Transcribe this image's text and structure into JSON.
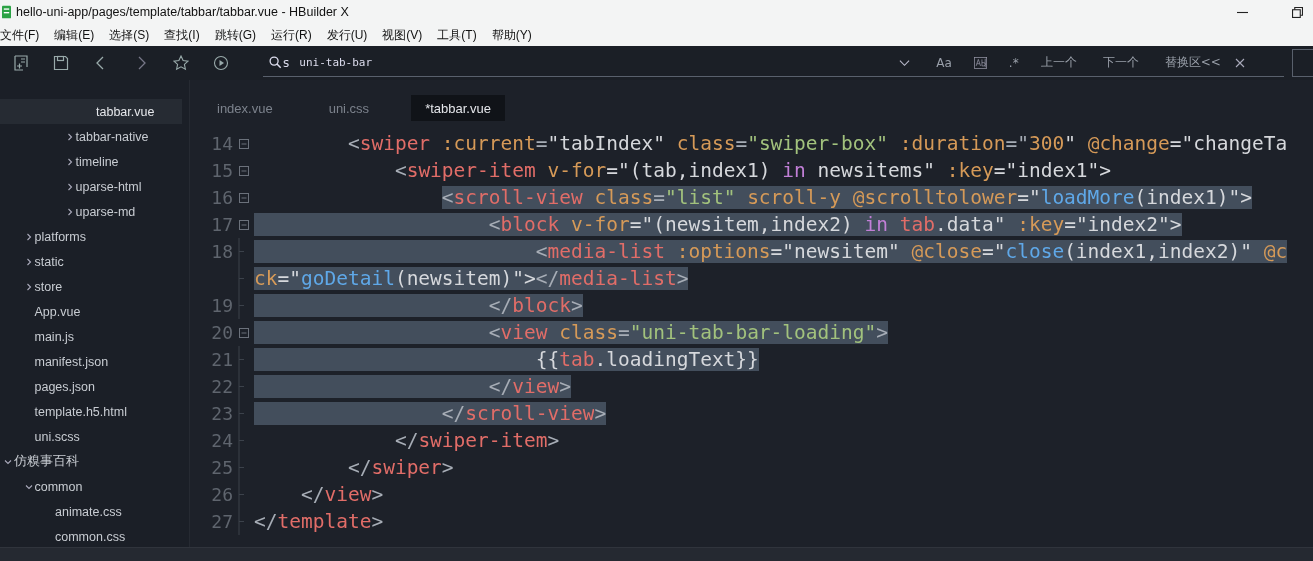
{
  "window": {
    "title": "hello-uni-app/pages/template/tabbar/tabbar.vue - HBuilder X"
  },
  "menu": [
    "文件(F)",
    "编辑(E)",
    "选择(S)",
    "查找(I)",
    "跳转(G)",
    "运行(R)",
    "发行(U)",
    "视图(V)",
    "工具(T)",
    "帮助(Y)"
  ],
  "search": {
    "mode": "s",
    "value": "uni-tab-bar",
    "case_label": "Aa",
    "regex_label": ".*",
    "prev": "上一个",
    "next": "下一个",
    "replace_toggle": "替换区<<"
  },
  "sidebar": {
    "items": [
      {
        "children": [
          {
            "children": [
              {
                "children": [
                  {
                    "children": [
                      {
                        "label": "tabbar.vue",
                        "kind": "file",
                        "selected": true
                      }
                    ]
                  },
                  {
                    "label": "tabbar-native",
                    "kind": "folder",
                    "expanded": false,
                    "selected": false
                  },
                  {
                    "label": "timeline",
                    "kind": "folder",
                    "expanded": false,
                    "selected": false
                  },
                  {
                    "label": "uparse-html",
                    "kind": "folder",
                    "expanded": false,
                    "selected": false
                  },
                  {
                    "label": "uparse-md",
                    "kind": "folder",
                    "expanded": false,
                    "selected": false
                  }
                ]
              }
            ]
          },
          {
            "label": "platforms",
            "kind": "folder",
            "expanded": false,
            "selected": false
          },
          {
            "label": "static",
            "kind": "folder",
            "expanded": false,
            "selected": false
          },
          {
            "label": "store",
            "kind": "folder",
            "expanded": false,
            "selected": false
          },
          {
            "label": "App.vue",
            "kind": "file",
            "selected": false
          },
          {
            "label": "main.js",
            "kind": "file",
            "selected": false
          },
          {
            "label": "manifest.json",
            "kind": "file",
            "selected": false
          },
          {
            "label": "pages.json",
            "kind": "file",
            "selected": false
          },
          {
            "label": "template.h5.html",
            "kind": "file",
            "selected": false
          },
          {
            "label": "uni.scss",
            "kind": "file",
            "selected": false
          }
        ]
      },
      {
        "label": "仿糗事百科",
        "kind": "folder",
        "expanded": true,
        "selected": false,
        "children": [
          {
            "label": "common",
            "kind": "folder",
            "expanded": true,
            "selected": false,
            "children": [
              {
                "label": "animate.css",
                "kind": "file",
                "selected": false
              },
              {
                "label": "common.css",
                "kind": "file",
                "selected": false
              }
            ]
          }
        ]
      }
    ]
  },
  "tabs": [
    {
      "label": "index.vue",
      "selected": false
    },
    {
      "label": "uni.css",
      "selected": false
    },
    {
      "label": "*tabbar.vue",
      "selected": true
    }
  ],
  "code": [
    {
      "number": "14",
      "fold": true,
      "selected": false,
      "tokens": [
        {
          "kind": "punct",
          "t": "        <"
        },
        {
          "kind": "tag",
          "t": "swiper"
        },
        {
          "kind": "attr",
          "t": " :current"
        },
        {
          "kind": "punct",
          "t": "="
        },
        {
          "kind": "plain",
          "t": "\"tabIndex\" "
        },
        {
          "kind": "attr",
          "t": "class"
        },
        {
          "kind": "punct",
          "t": "="
        },
        {
          "kind": "string",
          "t": "\"swiper-box\""
        },
        {
          "kind": "attr",
          "t": " :duration"
        },
        {
          "kind": "punct",
          "t": "=\""
        },
        {
          "kind": "attr",
          "t": "300"
        },
        {
          "kind": "plain",
          "t": "\" "
        },
        {
          "kind": "attr",
          "t": "@change"
        },
        {
          "kind": "plain",
          "t": "=\"changeTa"
        }
      ]
    },
    {
      "number": "15",
      "fold": true,
      "selected": false,
      "tokens": [
        {
          "kind": "punct",
          "t": "            <"
        },
        {
          "kind": "tag",
          "t": "swiper-item"
        },
        {
          "kind": "attr",
          "t": " v-for"
        },
        {
          "kind": "plain",
          "t": "=\"(tab,index1) "
        },
        {
          "kind": "keyword",
          "t": "in"
        },
        {
          "kind": "plain",
          "t": " newsitems\" "
        },
        {
          "kind": "attr",
          "t": ":key"
        },
        {
          "kind": "plain",
          "t": "=\"index1\">"
        }
      ]
    },
    {
      "number": "16",
      "fold": true,
      "selected": true,
      "tokens": [
        {
          "kind": "punct",
          "t": "                <"
        },
        {
          "kind": "tag",
          "t": "scroll-view"
        },
        {
          "kind": "attr",
          "t": " class"
        },
        {
          "kind": "punct",
          "t": "="
        },
        {
          "kind": "string",
          "t": "\"list\""
        },
        {
          "kind": "attr",
          "t": " scroll-y @scrolltolower"
        },
        {
          "kind": "plain",
          "t": "=\""
        },
        {
          "kind": "func",
          "t": "loadMore"
        },
        {
          "kind": "plain",
          "t": "(index1)\">"
        }
      ]
    },
    {
      "number": "17",
      "fold": true,
      "selected": true,
      "tokens": [
        {
          "kind": "punct",
          "t": "                    <"
        },
        {
          "kind": "tag",
          "t": "block"
        },
        {
          "kind": "attr",
          "t": " v-for"
        },
        {
          "kind": "plain",
          "t": "=\"(newsitem,index2) "
        },
        {
          "kind": "keyword",
          "t": "in"
        },
        {
          "kind": "var",
          "t": " tab"
        },
        {
          "kind": "plain",
          "t": ".data\" "
        },
        {
          "kind": "attr",
          "t": ":key"
        },
        {
          "kind": "plain",
          "t": "=\"index2\">"
        }
      ]
    },
    {
      "number": "18",
      "fold": false,
      "selected": true,
      "tokens": [
        {
          "kind": "punct",
          "t": "                        <"
        },
        {
          "kind": "tag",
          "t": "media-list"
        },
        {
          "kind": "attr",
          "t": " :options"
        },
        {
          "kind": "plain",
          "t": "=\"newsitem\" "
        },
        {
          "kind": "attr",
          "t": "@close"
        },
        {
          "kind": "plain",
          "t": "=\""
        },
        {
          "kind": "func",
          "t": "close"
        },
        {
          "kind": "plain",
          "t": "(index1,index2)\" "
        },
        {
          "kind": "attr",
          "t": "@c"
        }
      ]
    },
    {
      "fold": false,
      "selected": true,
      "tokens": [
        {
          "kind": "attr",
          "t": "ck"
        },
        {
          "kind": "plain",
          "t": "=\""
        },
        {
          "kind": "func",
          "t": "goDetail"
        },
        {
          "kind": "plain",
          "t": "(newsitem)\">"
        },
        {
          "kind": "punct",
          "t": "</"
        },
        {
          "kind": "tag",
          "t": "media-list"
        },
        {
          "kind": "punct",
          "t": ">"
        }
      ]
    },
    {
      "number": "19",
      "fold": false,
      "selected": true,
      "tokens": [
        {
          "kind": "punct",
          "t": "                    </"
        },
        {
          "kind": "tag",
          "t": "block"
        },
        {
          "kind": "punct",
          "t": ">"
        }
      ]
    },
    {
      "number": "20",
      "fold": true,
      "selected": true,
      "tokens": [
        {
          "kind": "punct",
          "t": "                    <"
        },
        {
          "kind": "tag",
          "t": "view"
        },
        {
          "kind": "attr",
          "t": " class"
        },
        {
          "kind": "punct",
          "t": "="
        },
        {
          "kind": "string",
          "t": "\"uni-tab-bar-loading\""
        },
        {
          "kind": "punct",
          "t": ">"
        }
      ]
    },
    {
      "number": "21",
      "fold": false,
      "selected": true,
      "tokens": [
        {
          "kind": "plain",
          "t": "                        {{"
        },
        {
          "kind": "var",
          "t": "tab"
        },
        {
          "kind": "plain",
          "t": ".loadingText}}"
        }
      ]
    },
    {
      "number": "22",
      "fold": false,
      "selected": true,
      "tokens": [
        {
          "kind": "punct",
          "t": "                    </"
        },
        {
          "kind": "tag",
          "t": "view"
        },
        {
          "kind": "punct",
          "t": ">"
        }
      ]
    },
    {
      "number": "23",
      "fold": false,
      "selected": true,
      "tokens": [
        {
          "kind": "punct",
          "t": "                </"
        },
        {
          "kind": "tag",
          "t": "scroll-view"
        },
        {
          "kind": "punct",
          "t": ">"
        }
      ]
    },
    {
      "number": "24",
      "fold": false,
      "selected": false,
      "tokens": [
        {
          "kind": "punct",
          "t": "            </"
        },
        {
          "kind": "tag",
          "t": "swiper-item"
        },
        {
          "kind": "punct",
          "t": ">"
        }
      ]
    },
    {
      "number": "25",
      "fold": false,
      "selected": false,
      "tokens": [
        {
          "kind": "punct",
          "t": "        </"
        },
        {
          "kind": "tag",
          "t": "swiper"
        },
        {
          "kind": "punct",
          "t": ">"
        }
      ]
    },
    {
      "number": "26",
      "fold": false,
      "selected": false,
      "tokens": [
        {
          "kind": "punct",
          "t": "    </"
        },
        {
          "kind": "tag",
          "t": "view"
        },
        {
          "kind": "punct",
          "t": ">"
        }
      ]
    },
    {
      "number": "27",
      "fold": false,
      "selected": false,
      "tokens": [
        {
          "kind": "punct",
          "t": "</"
        },
        {
          "kind": "tag",
          "t": "template"
        },
        {
          "kind": "punct",
          "t": ">"
        }
      ]
    }
  ]
}
